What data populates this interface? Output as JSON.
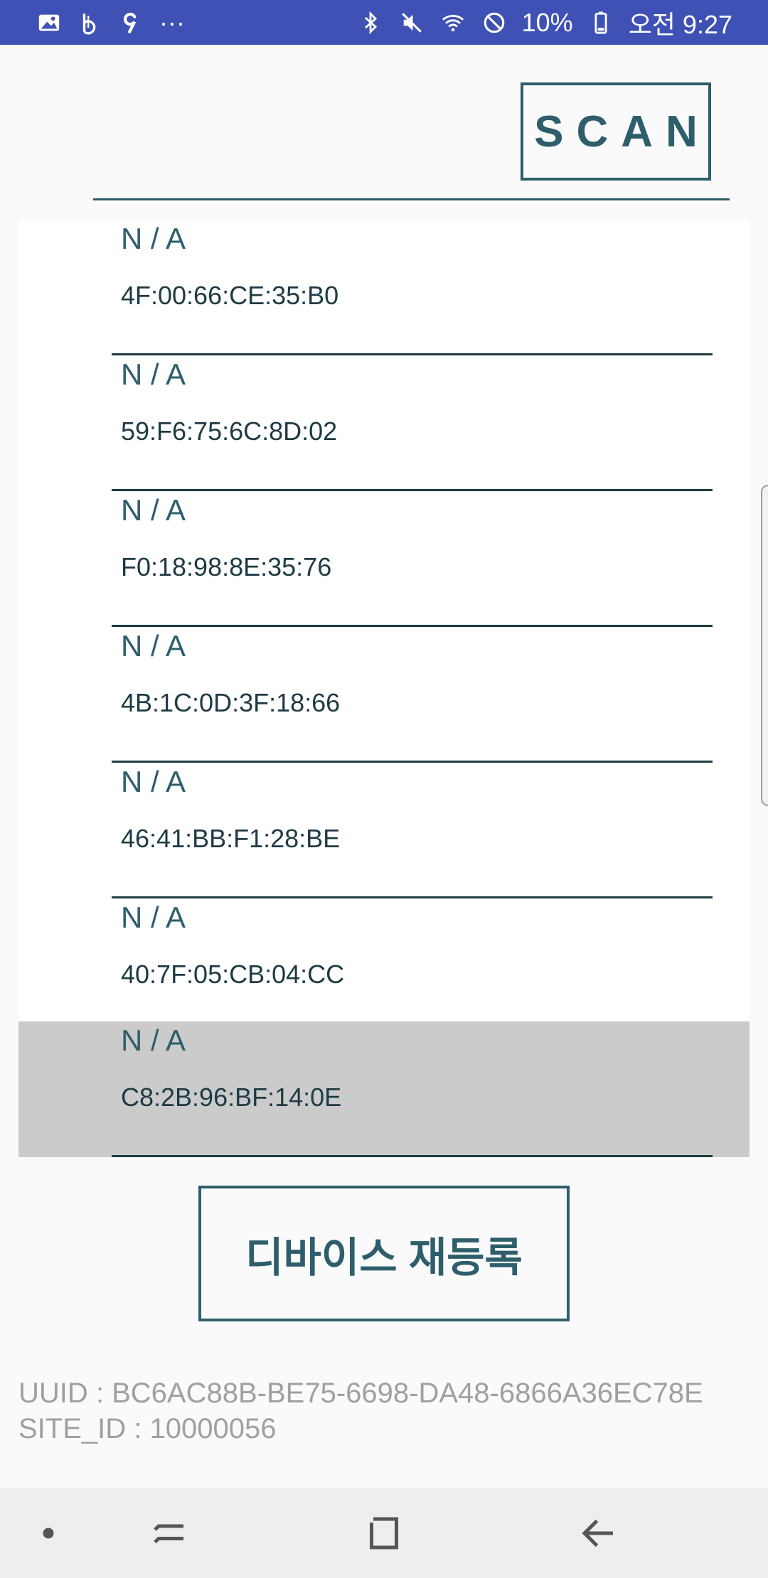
{
  "status_bar": {
    "left_icons": [
      "gallery-icon",
      "b-app-icon",
      "app-9-icon",
      "more-dots-icon"
    ],
    "right_icons": [
      "bluetooth-icon",
      "mute-icon",
      "wifi-icon",
      "no-disturb-icon",
      "battery-icon"
    ],
    "battery_text": "10%",
    "time_text": "오전 9:27",
    "more_text": "···",
    "color": "#3f51b5"
  },
  "header": {
    "scan_label": "SCAN"
  },
  "devices": [
    {
      "name": "N / A",
      "mac": "4F:00:66:CE:35:B0",
      "selected": false
    },
    {
      "name": "N / A",
      "mac": "59:F6:75:6C:8D:02",
      "selected": false
    },
    {
      "name": "N / A",
      "mac": "F0:18:98:8E:35:76",
      "selected": false
    },
    {
      "name": "N / A",
      "mac": "4B:1C:0D:3F:18:66",
      "selected": false
    },
    {
      "name": "N / A",
      "mac": "46:41:BB:F1:28:BE",
      "selected": false
    },
    {
      "name": "N / A",
      "mac": "40:7F:05:CB:04:CC",
      "selected": false
    },
    {
      "name": "N / A",
      "mac": "C8:2B:96:BF:14:0E",
      "selected": true
    }
  ],
  "actions": {
    "reregister_label": "디바이스 재등록"
  },
  "info": {
    "uuid_line": "UUID : BC6AC88B-BE75-6698-DA48-6866A36EC78E",
    "site_line": "SITE_ID : 10000056"
  },
  "nav_bar": {
    "buttons": [
      "nav-dot-icon",
      "recent-apps-icon",
      "home-icon",
      "back-icon"
    ]
  },
  "colors": {
    "accent": "#2e5e6b",
    "selected_row": "#cbcbcb",
    "info_text": "#a0a0a0"
  }
}
